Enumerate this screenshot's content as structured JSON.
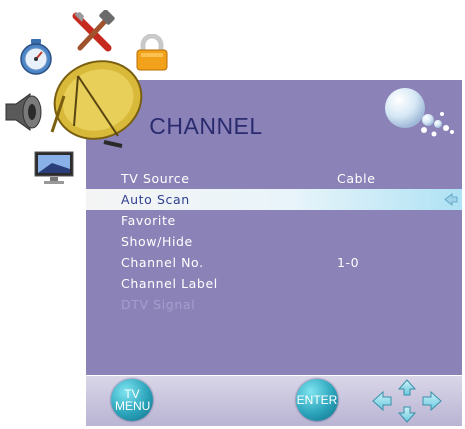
{
  "menu": {
    "title": "CHANNEL",
    "items": [
      {
        "label": "TV Source",
        "value": "Cable",
        "state": "normal"
      },
      {
        "label": "Auto Scan",
        "value": "",
        "state": "selected"
      },
      {
        "label": "Favorite",
        "value": "",
        "state": "normal"
      },
      {
        "label": "Show/Hide",
        "value": "",
        "state": "normal"
      },
      {
        "label": "Channel No.",
        "value": "1-0",
        "state": "normal"
      },
      {
        "label": "Channel Label",
        "value": "",
        "state": "normal"
      },
      {
        "label": "DTV Signal",
        "value": "",
        "state": "disabled"
      }
    ]
  },
  "footer": {
    "menu_button": "TV MENU",
    "enter_button": "ENTER"
  },
  "colors": {
    "panel": "#8b83b8",
    "title": "#2a2a6e",
    "selected_text": "#2f3f8f"
  },
  "icons": [
    "timer-icon",
    "tools-icon",
    "lock-icon",
    "speaker-icon",
    "satellite-dish-icon",
    "monitor-icon",
    "bubbles-icon",
    "nav-arrows-icon"
  ]
}
